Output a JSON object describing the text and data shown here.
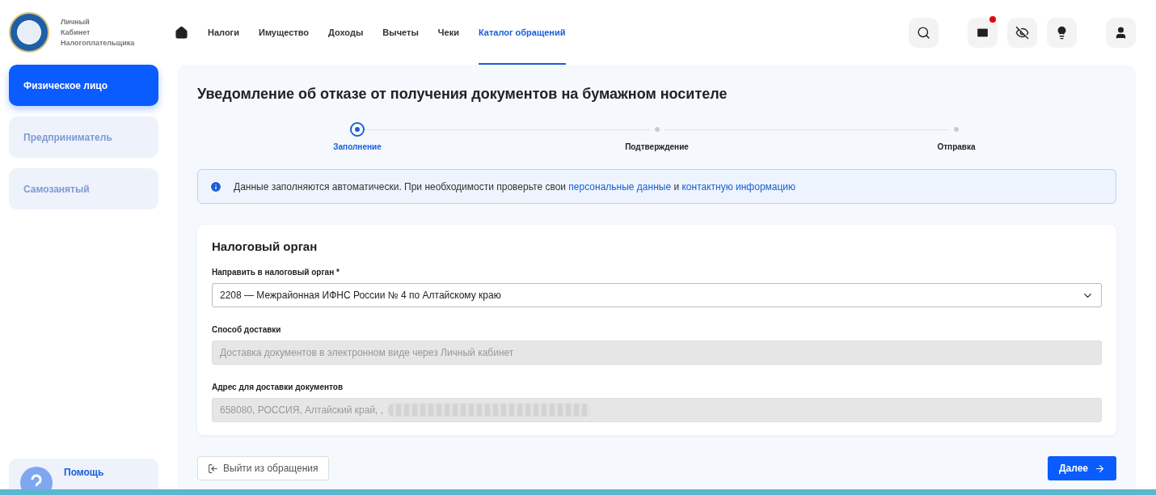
{
  "brand": {
    "lines": [
      "Личный",
      "Кабинет",
      "Налогоплательщика"
    ]
  },
  "nav": [
    {
      "label": "Налоги",
      "selected": false
    },
    {
      "label": "Имущество",
      "selected": false
    },
    {
      "label": "Доходы",
      "selected": false
    },
    {
      "label": "Вычеты",
      "selected": false
    },
    {
      "label": "Чеки",
      "selected": false
    },
    {
      "label": "Каталог обращений",
      "selected": true
    }
  ],
  "header_actions": {
    "mail_unread": true
  },
  "sidebar": {
    "items": [
      {
        "label": "Физическое лицо",
        "selected": true
      },
      {
        "label": "Предприниматель",
        "selected": false
      },
      {
        "label": "Самозанятый",
        "selected": false
      }
    ],
    "help": {
      "title": "Помощь"
    }
  },
  "page": {
    "title": "Уведомление об отказе от получения документов на бумажном носителе",
    "steps": [
      {
        "label": "Заполнение",
        "selected": true
      },
      {
        "label": "Подтверждение",
        "selected": false
      },
      {
        "label": "Отправка",
        "selected": false
      }
    ],
    "info": {
      "text": "Данные заполняются автоматически. При необходимости проверьте свои",
      "link1": "персональные данные",
      "joiner": "и",
      "link2": "контактную информацию"
    },
    "card": {
      "title": "Налоговый орган",
      "fields": [
        {
          "kind": "select",
          "label": "Направить в налоговый орган *",
          "value": "2208 — Межрайонная ИФНС России № 4 по Алтайскому краю",
          "disabled": false
        },
        {
          "kind": "text",
          "label": "Способ доставки",
          "value": "Доставка документов в электронном виде через Личный кабинет",
          "disabled": true
        },
        {
          "kind": "text",
          "label": "Адрес для доставки документов",
          "value": "658080, РОССИЯ, Алтайский край, ,",
          "disabled": true,
          "redacted": true
        }
      ]
    },
    "buttons": {
      "exit": "Выйти из обращения",
      "next": "Далее"
    }
  }
}
